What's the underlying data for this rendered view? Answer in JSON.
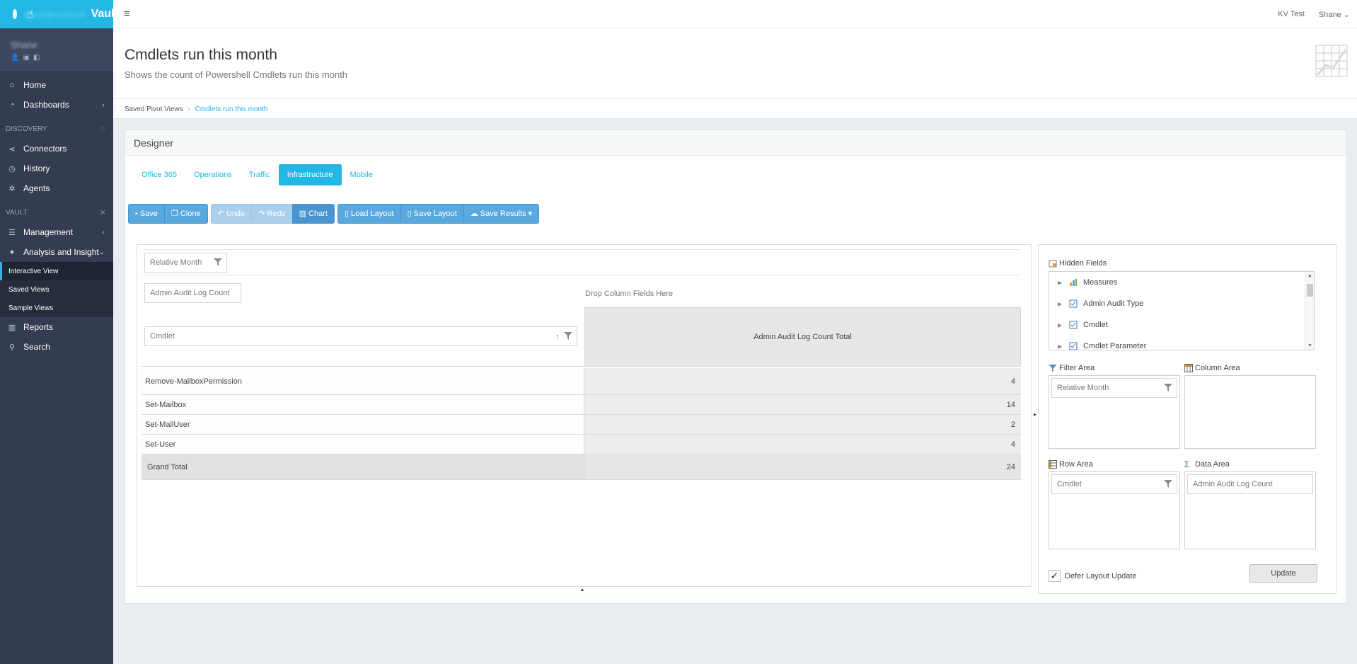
{
  "brand": {
    "name": "Vault",
    "blurred_prefix": "Quadrotech"
  },
  "user": {
    "name": "Shane"
  },
  "nav": {
    "home": "Home",
    "dashboards": "Dashboards",
    "discovery_header": "DISCOVERY",
    "connectors": "Connectors",
    "history": "History",
    "agents": "Agents",
    "vault_header": "VAULT",
    "management": "Management",
    "analysis": "Analysis and Insight",
    "sub": [
      "Interactive View",
      "Saved Views",
      "Sample Views"
    ],
    "reports": "Reports",
    "search": "Search"
  },
  "topbar": {
    "menu_icon": "≡",
    "tenant": "KV Test",
    "user": "Shane"
  },
  "page": {
    "title": "Cmdlets run this month",
    "subtitle": "Shows the count of Powershell Cmdlets run this month"
  },
  "breadcrumb": {
    "root": "Saved Pivot Views",
    "current": "Cmdlets run this month"
  },
  "designer": {
    "title": "Designer",
    "tabs": [
      "Office 365",
      "Operations",
      "Traffic",
      "Infrastructure",
      "Mobile"
    ],
    "active_tab": "Infrastructure",
    "toolbar": {
      "save": "Save",
      "clone": "Clone",
      "undo": "Undo",
      "redo": "Redo",
      "chart": "Chart",
      "load_layout": "Load Layout",
      "save_layout": "Save Layout",
      "save_results": "Save Results"
    }
  },
  "pivot": {
    "filter_field": "Relative Month",
    "data_field": "Admin Audit Log Count",
    "drop_column_text": "Drop Column Fields Here",
    "row_field": "Cmdlet",
    "column_total_header": "Admin Audit Log Count Total",
    "rows": [
      {
        "label": "Remove-MailboxPermission",
        "value": "4"
      },
      {
        "label": "Set-Mailbox",
        "value": "14"
      },
      {
        "label": "Set-MailUser",
        "value": "2"
      },
      {
        "label": "Set-User",
        "value": "4"
      }
    ],
    "grand_total_label": "Grand Total",
    "grand_total_value": "24"
  },
  "fieldlist": {
    "hidden_fields_label": "Hidden Fields",
    "hidden_fields": [
      "Measures",
      "Admin Audit Type",
      "Cmdlet",
      "Cmdlet Parameter"
    ],
    "filter_area_label": "Filter Area",
    "column_area_label": "Column Area",
    "row_area_label": "Row Area",
    "data_area_label": "Data Area",
    "filter_area_field": "Relative Month",
    "row_area_field": "Cmdlet",
    "data_area_field": "Admin Audit Log Count",
    "defer_label": "Defer Layout Update",
    "defer_checked": true,
    "update_label": "Update"
  },
  "colors": {
    "accent": "#23b7e5",
    "sidebar": "#333c50",
    "button": "#5aa9de"
  }
}
